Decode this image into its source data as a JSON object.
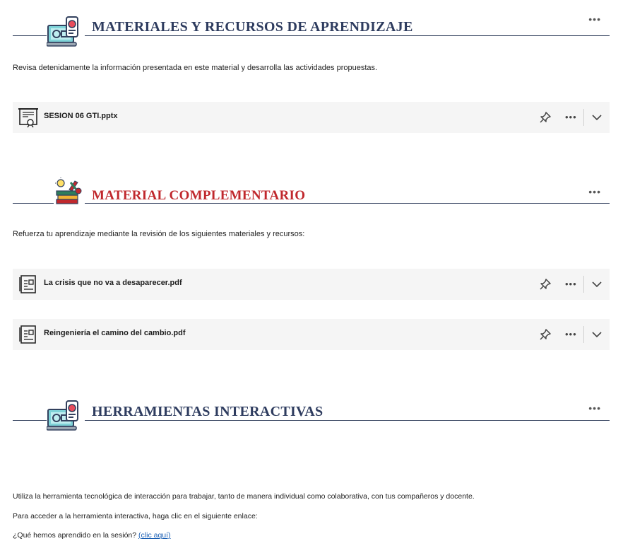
{
  "sections": [
    {
      "title": "MATERIALES Y RECURSOS DE APRENDIZAJE",
      "title_color": "#2e3c5f",
      "icon": "laptop-video-icon",
      "more_label": "•••",
      "description": "Revisa detenidamente la información presentada en este material y desarrolla las actividades propuestas.",
      "files": [
        {
          "name": "SESION 06 GTI.pptx",
          "icon": "presentation-file-icon"
        }
      ]
    },
    {
      "title": "MATERIAL COMPLEMENTARIO",
      "title_color": "#c0282d",
      "icon": "books-idea-icon",
      "more_label": "•••",
      "description": "Refuerza tu aprendizaje mediante la revisión de los siguientes materiales y recursos:",
      "files": [
        {
          "name": "La crisis que no va a desaparecer.pdf",
          "icon": "document-file-icon"
        },
        {
          "name": "Reingeniería el camino del cambio.pdf",
          "icon": "document-file-icon"
        }
      ]
    },
    {
      "title": "HERRAMIENTAS INTERACTIVAS",
      "title_color": "#2e3c5f",
      "icon": "laptop-video-icon",
      "more_label": "•••",
      "paragraphs": [
        "Utiliza la herramienta tecnológica de interacción para trabajar, tanto de manera individual como colaborativa, con tus compañeros y docente.",
        "Para acceder a la herramienta interactiva, haga clic en el siguiente enlace:"
      ],
      "question_text": "¿Qué hemos aprendido en la sesión?",
      "link_text": "(clic aquí)"
    }
  ],
  "file_actions": {
    "more_label": "•••"
  }
}
